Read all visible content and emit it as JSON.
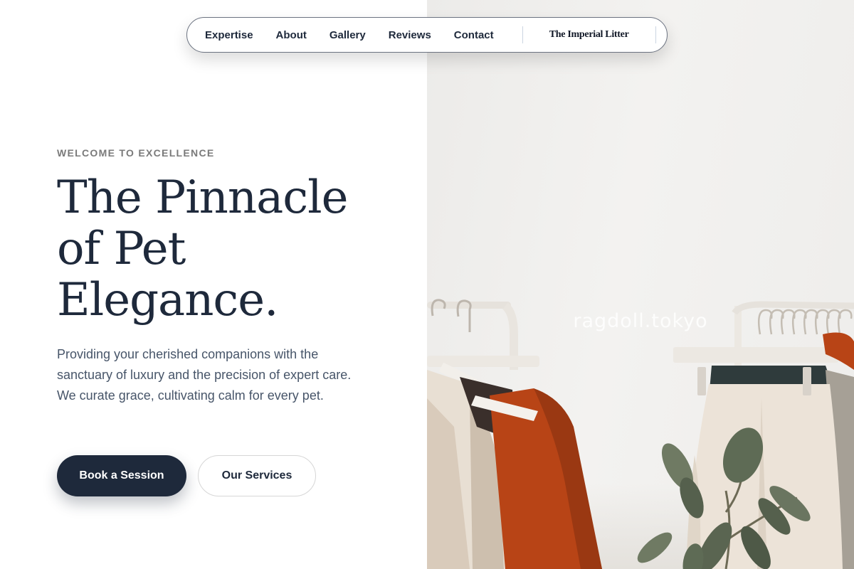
{
  "nav": {
    "items": [
      {
        "label": "Expertise"
      },
      {
        "label": "About"
      },
      {
        "label": "Gallery"
      },
      {
        "label": "Reviews"
      },
      {
        "label": "Contact"
      }
    ],
    "brand": "The Imperial Litter"
  },
  "hero": {
    "eyebrow": "WELCOME TO EXCELLENCE",
    "headline_lines": [
      "The Pinnacle",
      "of Pet",
      "Elegance."
    ],
    "intro": "Providing your cherished companions with the sanctuary of luxury and the precision of expert care. We curate grace, cultivating calm for every pet.",
    "primary_cta": "Book a Session",
    "secondary_cta": "Our Services"
  },
  "image": {
    "watermark": "ragdoll.tokyo"
  },
  "colors": {
    "primary": "#1e293b",
    "body_text": "#475569",
    "eyebrow": "#7a7a7a",
    "rust_garment": "#b84416",
    "plant": "#5e6b55"
  }
}
